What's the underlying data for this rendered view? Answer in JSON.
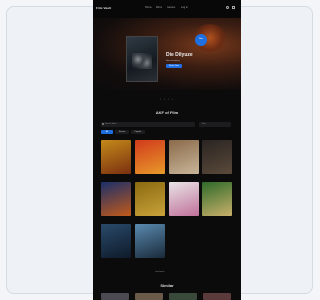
{
  "nav": {
    "logo": "Film Vault",
    "items": [
      "Home",
      "Films",
      "Genres",
      "Log in"
    ]
  },
  "hero": {
    "title": "Die Dilyuze",
    "subtitle": "Now streaming",
    "button": "Watch Now",
    "badge": "New"
  },
  "carousel_dots": "• • • •",
  "section": {
    "title": "AKF of Film"
  },
  "filters": {
    "search_placeholder": "Search films...",
    "sort_label": "Sort",
    "tabs": [
      "All",
      "Recent",
      "Popular"
    ]
  },
  "tiles": [
    {
      "label": "Film title",
      "colors": [
        "#c48a1a",
        "#7a2f10"
      ]
    },
    {
      "label": "Film title",
      "colors": [
        "#d13a1c",
        "#e89a2a"
      ]
    },
    {
      "label": "Film title",
      "colors": [
        "#8a6a4a",
        "#c9b59a"
      ]
    },
    {
      "label": "Film title",
      "colors": [
        "#2a2422",
        "#5a4a3a"
      ]
    },
    {
      "label": "Film title",
      "colors": [
        "#1b2f6a",
        "#c25a1a"
      ]
    },
    {
      "label": "Film title",
      "colors": [
        "#8a6a10",
        "#c9a23a"
      ]
    },
    {
      "label": "Film title",
      "colors": [
        "#e8e4e6",
        "#c0709a"
      ]
    },
    {
      "label": "Film title",
      "colors": [
        "#2e6a2a",
        "#c9b06a"
      ]
    },
    {
      "label": "Film title",
      "colors": [
        "#2a4a6a",
        "#0e1a2a"
      ]
    },
    {
      "label": "Film title",
      "colors": [
        "#5a8ab0",
        "#1a2a3a"
      ]
    }
  ],
  "load_more": "Load more",
  "bottom_section": "Similar",
  "bottom_thumbs": [
    "#4a4a50",
    "#6a5a4a",
    "#3a4a3a",
    "#5a3a3a"
  ],
  "accent": "#1f6fe0"
}
